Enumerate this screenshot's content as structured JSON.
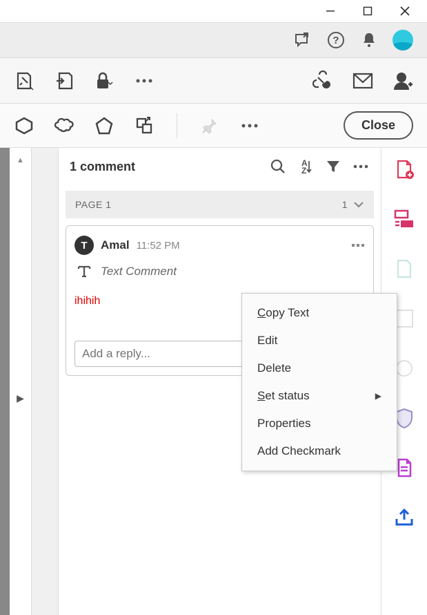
{
  "window": {
    "minimize": "—",
    "maximize": "□",
    "close": "✕"
  },
  "toolbar3": {
    "close_label": "Close"
  },
  "comments": {
    "header_title": "1 comment",
    "page_label": "PAGE 1",
    "page_count": "1",
    "card": {
      "avatar_letter": "T",
      "author": "Amal",
      "time": "11:52 PM",
      "type_label": "Text Comment",
      "body": "ihihih",
      "reply_placeholder": "Add a reply..."
    }
  },
  "context_menu": {
    "copy": {
      "u": "C",
      "rest": "opy Text"
    },
    "edit": "Edit",
    "delete": "Delete",
    "set_status": {
      "u": "S",
      "rest": "et status"
    },
    "properties": "Properties",
    "add_checkmark": "Add Checkmark"
  }
}
